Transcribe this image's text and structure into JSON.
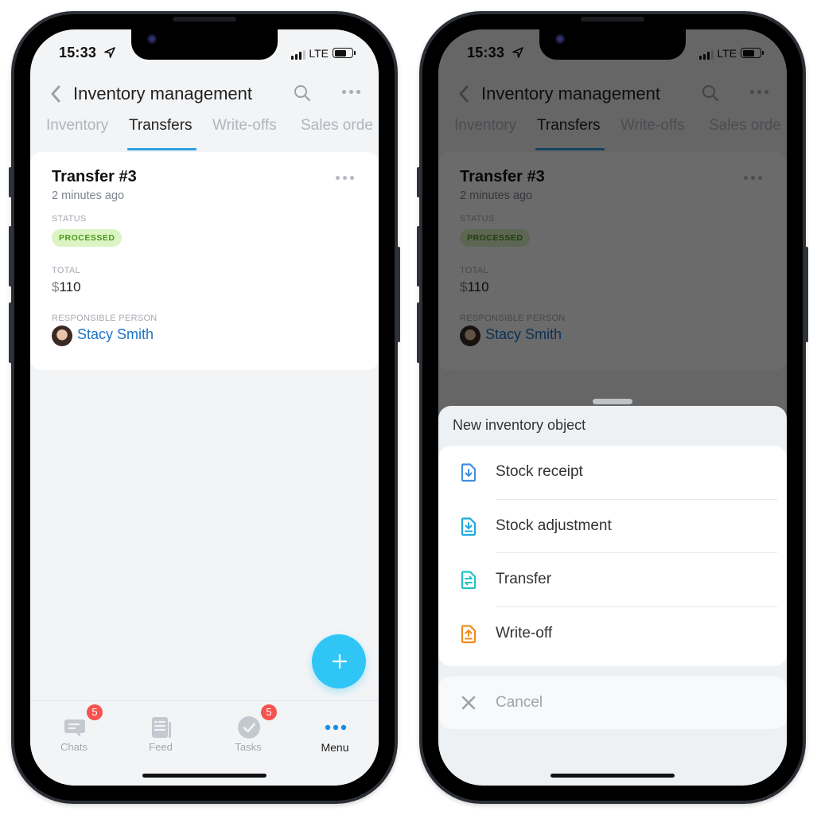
{
  "colors": {
    "accent": "#2fa0e5",
    "fab": "#2fc6f6",
    "link": "#1d74c5",
    "badge_bg": "#dcf4c3",
    "badge_text": "#4b9a1b",
    "notification": "#f4534f",
    "stock_receipt": "#3e8ee0",
    "stock_adjustment": "#1ea8dc",
    "transfer": "#22c2c0",
    "write_off": "#f08a1c"
  },
  "phones": [
    {
      "status_bar": {
        "time": "15:33",
        "network": "LTE"
      },
      "nav": {
        "title": "Inventory management"
      },
      "tabs": [
        {
          "label": "Inventory",
          "active": false
        },
        {
          "label": "Transfers",
          "active": true
        },
        {
          "label": "Write-offs",
          "active": false
        },
        {
          "label": "Sales orde",
          "active": false
        }
      ],
      "card": {
        "title": "Transfer #3",
        "subtitle": "2 minutes ago",
        "status_label": "STATUS",
        "status_value": "PROCESSED",
        "total_label": "TOTAL",
        "total_currency": "$",
        "total_amount": "110",
        "person_label": "RESPONSIBLE PERSON",
        "person_name": "Stacy Smith"
      },
      "tabbar": [
        {
          "label": "Chats",
          "icon": "chat-icon",
          "badge": "5",
          "active": false
        },
        {
          "label": "Feed",
          "icon": "feed-icon",
          "badge": null,
          "active": false
        },
        {
          "label": "Tasks",
          "icon": "tasks-icon",
          "badge": "5",
          "active": false
        },
        {
          "label": "Menu",
          "icon": "more-dots-icon",
          "badge": null,
          "active": true
        }
      ]
    },
    {
      "status_bar": {
        "time": "15:33",
        "network": "LTE"
      },
      "nav": {
        "title": "Inventory management"
      },
      "tabs": [
        {
          "label": "Inventory",
          "active": false
        },
        {
          "label": "Transfers",
          "active": true
        },
        {
          "label": "Write-offs",
          "active": false
        },
        {
          "label": "Sales orde",
          "active": false
        }
      ],
      "card": {
        "title": "Transfer #3",
        "subtitle": "2 minutes ago",
        "status_label": "STATUS",
        "status_value": "PROCESSED",
        "total_label": "TOTAL",
        "total_currency": "$",
        "total_amount": "110",
        "person_label": "RESPONSIBLE PERSON",
        "person_name": "Stacy Smith"
      },
      "sheet": {
        "title": "New inventory object",
        "items": [
          {
            "label": "Stock receipt",
            "icon": "document-download-icon"
          },
          {
            "label": "Stock adjustment",
            "icon": "document-import-icon"
          },
          {
            "label": "Transfer",
            "icon": "document-transfer-icon"
          },
          {
            "label": "Write-off",
            "icon": "document-upload-icon"
          }
        ],
        "cancel_label": "Cancel"
      }
    }
  ]
}
